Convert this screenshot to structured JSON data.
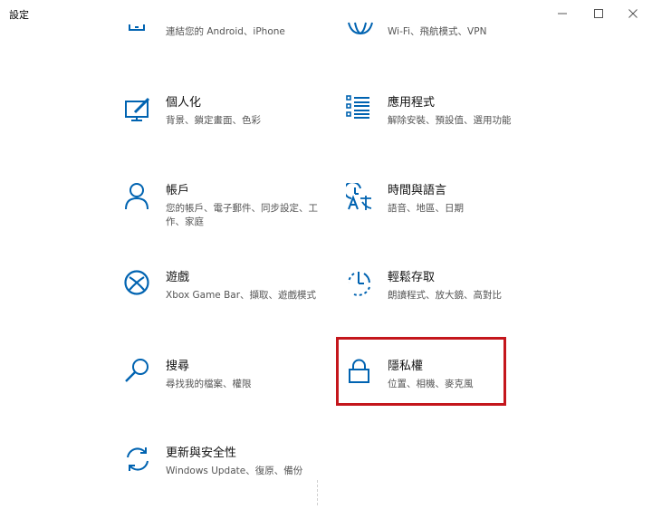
{
  "window": {
    "title": "設定",
    "minimize_icon": "minimize-icon",
    "maximize_icon": "maximize-icon",
    "close_icon": "close-icon"
  },
  "tiles": [
    {
      "title": "",
      "desc": "連結您的 Android、iPhone",
      "icon": "phone-icon"
    },
    {
      "title": "",
      "desc": "Wi-Fi、飛航模式、VPN",
      "icon": "globe-icon"
    },
    {
      "title": "個人化",
      "desc": "背景、鎖定畫面、色彩",
      "icon": "personalization-icon"
    },
    {
      "title": "應用程式",
      "desc": "解除安裝、預設值、選用功能",
      "icon": "apps-list-icon"
    },
    {
      "title": "帳戶",
      "desc": "您的帳戶、電子郵件、同步設定、工作、家庭",
      "icon": "person-icon"
    },
    {
      "title": "時間與語言",
      "desc": "語音、地區、日期",
      "icon": "time-language-icon"
    },
    {
      "title": "遊戲",
      "desc": "Xbox Game Bar、擷取、遊戲模式",
      "icon": "xbox-icon"
    },
    {
      "title": "輕鬆存取",
      "desc": "朗讀程式、放大鏡、高對比",
      "icon": "ease-of-access-icon"
    },
    {
      "title": "搜尋",
      "desc": "尋找我的檔案、權限",
      "icon": "search-icon"
    },
    {
      "title": "隱私權",
      "desc": "位置、相機、麥克風",
      "icon": "lock-icon"
    },
    {
      "title": "更新與安全性",
      "desc": "Windows Update、復原、備份",
      "icon": "update-sync-icon"
    }
  ],
  "colors": {
    "accent": "#0063b1",
    "highlight": "#c4161c"
  }
}
